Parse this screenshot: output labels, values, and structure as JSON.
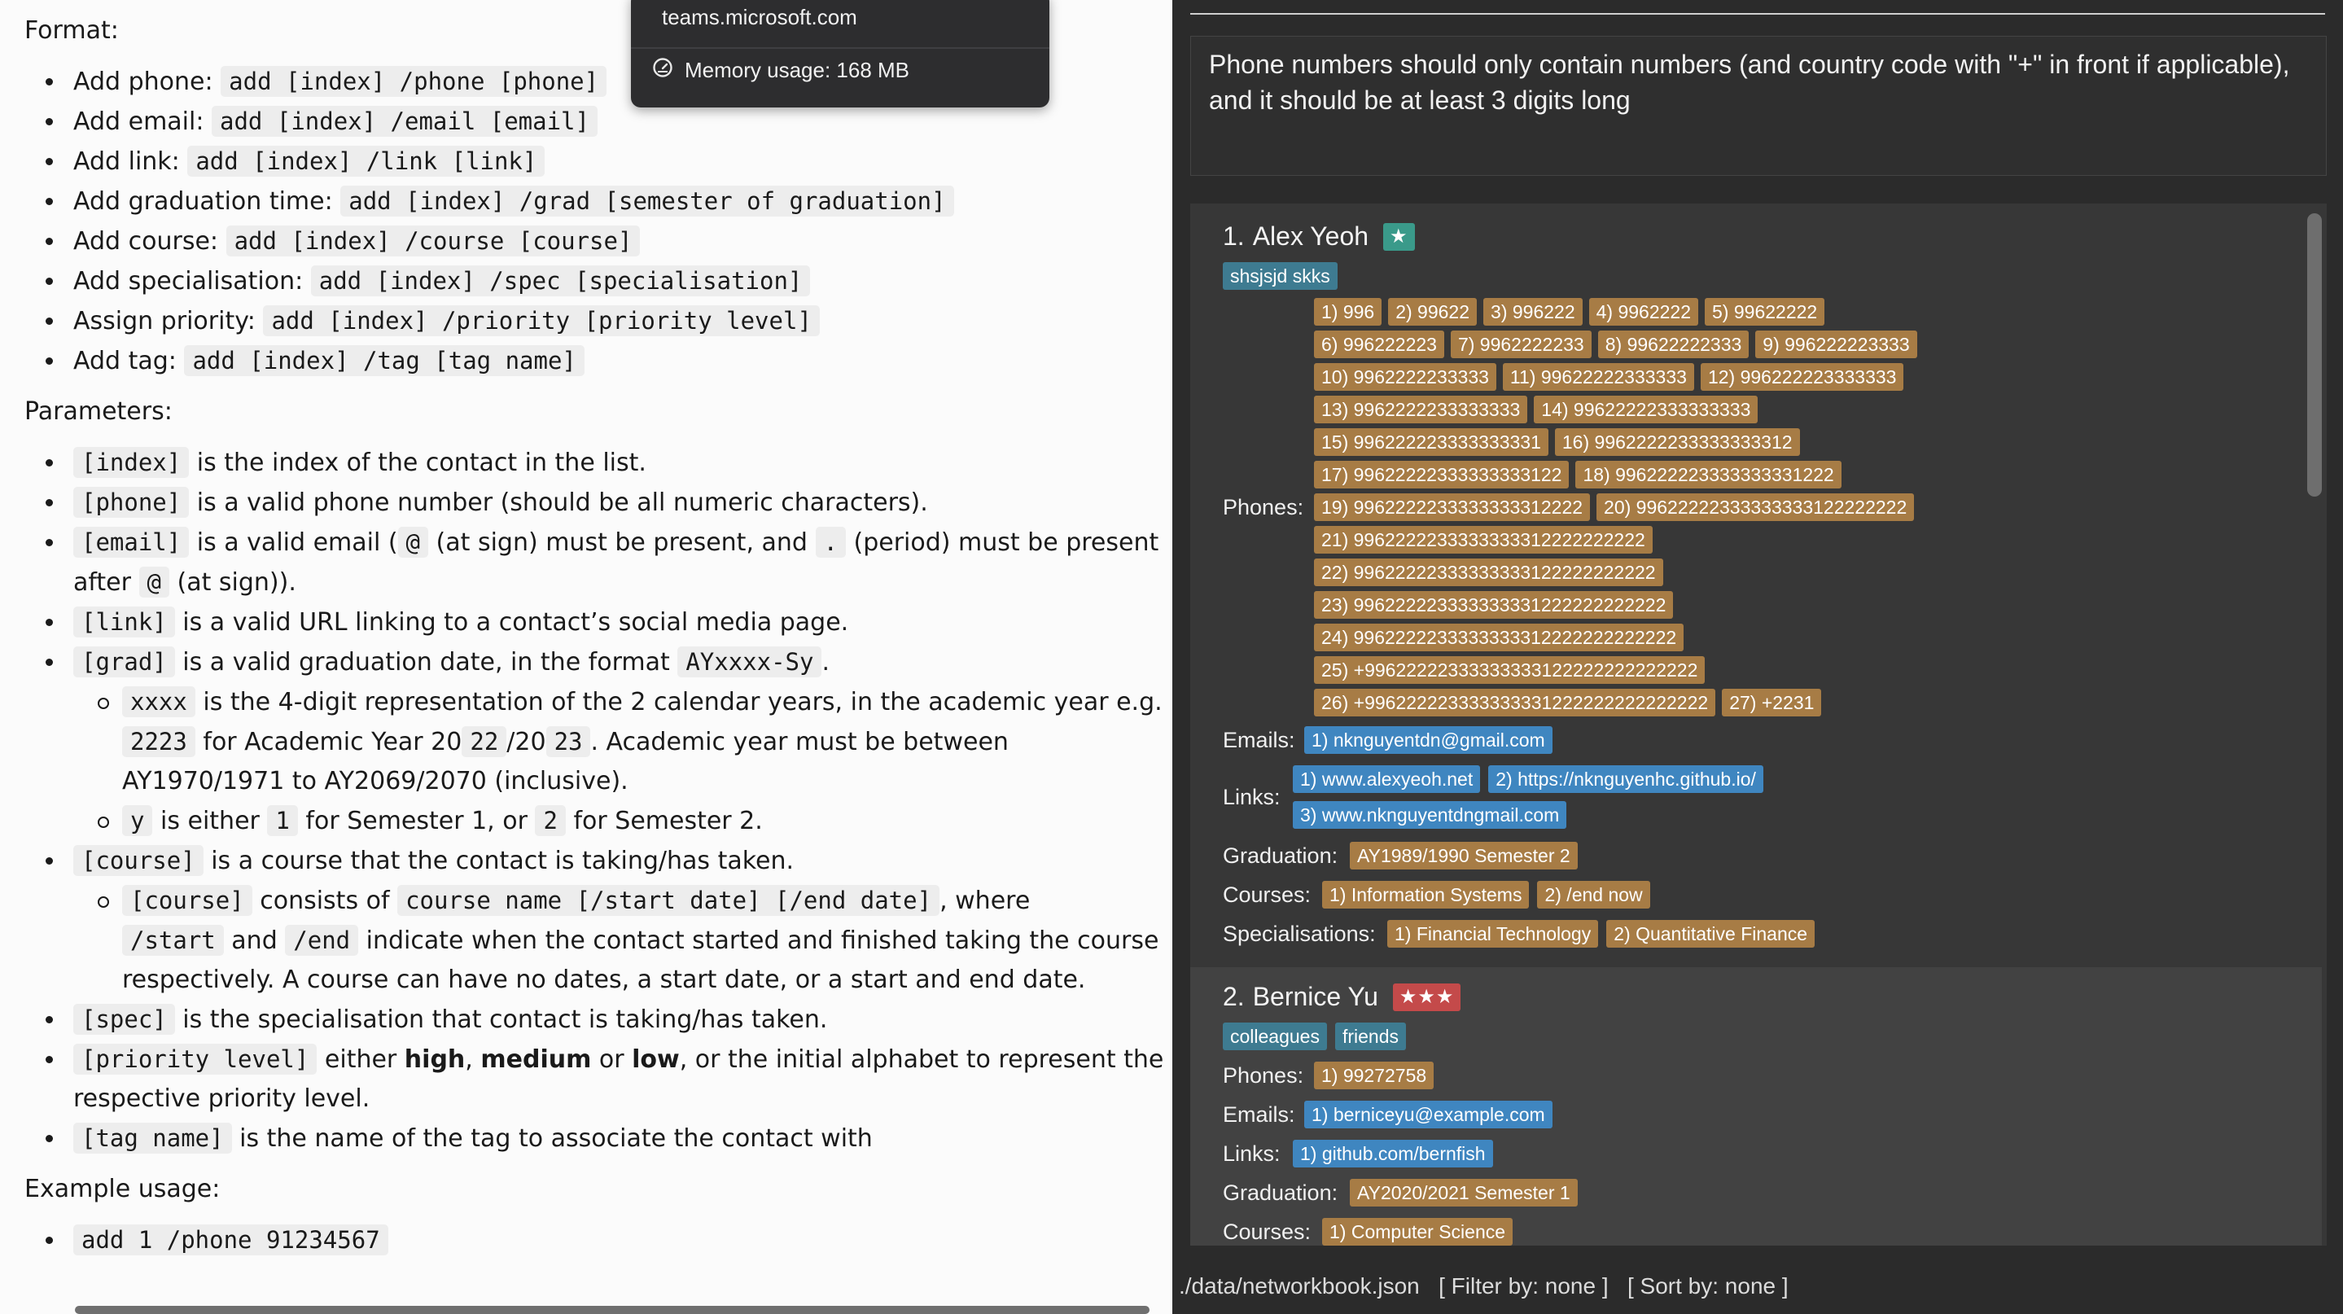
{
  "help": {
    "format_heading": "Format:",
    "format_items": [
      {
        "label": "Add phone:",
        "code": "add [index] /phone [phone]"
      },
      {
        "label": "Add email:",
        "code": "add [index] /email [email]"
      },
      {
        "label": "Add link:",
        "code": "add [index] /link [link]"
      },
      {
        "label": "Add graduation time:",
        "code": "add [index] /grad [semester of graduation]"
      },
      {
        "label": "Add course:",
        "code": "add [index] /course [course]"
      },
      {
        "label": "Add specialisation:",
        "code": "add [index] /spec [specialisation]"
      },
      {
        "label": "Assign priority:",
        "code": "add [index] /priority [priority level]"
      },
      {
        "label": "Add tag:",
        "code": "add [index] /tag [tag name]"
      }
    ],
    "params_heading": "Parameters:",
    "p_index_code": "[index]",
    "p_index_text": " is the index of the contact in the list.",
    "p_phone_code": "[phone]",
    "p_phone_text": " is a valid phone number (should be all numeric characters).",
    "p_email_code": "[email]",
    "p_email_t1": " is a valid email (",
    "p_email_at": "@",
    "p_email_t2": " (at sign) must be present, and ",
    "p_email_dot": ".",
    "p_email_t3": " (period) must be present",
    "p_email_t4": "after ",
    "p_email_t5": " (at sign)).",
    "p_link_code": "[link]",
    "p_link_text": " is a valid URL linking to a contact’s social media page.",
    "p_grad_code": "[grad]",
    "p_grad_t1": " is a valid graduation date, in the format ",
    "p_grad_fmt": "AYxxxx-Sy",
    "p_grad_t2": ".",
    "s_xxxx_code": "xxxx",
    "s_xxxx_t1": " is the 4-digit representation of the 2 calendar years, in the academic year e.g.",
    "s_xxxx_ex": "2223",
    "s_xxxx_t2": " for Academic Year 20",
    "s_xxxx_22": "22",
    "s_xxxx_t3": "/20",
    "s_xxxx_23": "23",
    "s_xxxx_t4": ". Academic year must be between",
    "s_xxxx_t5": "AY1970/1971 to AY2069/2070 (inclusive).",
    "s_y_code": "y",
    "s_y_t1": " is either ",
    "s_y_1": "1",
    "s_y_t2": " for Semester 1, or ",
    "s_y_2": "2",
    "s_y_t3": " for Semester 2.",
    "p_course_code": "[course]",
    "p_course_text": " is a course that the contact is taking/has taken.",
    "s_course_code": "[course]",
    "s_course_t1": " consists of ",
    "s_course_fmt": "course name [/start date] [/end date]",
    "s_course_t2": ", where",
    "s_course_start": "/start",
    "s_course_t3": " and ",
    "s_course_end": "/end",
    "s_course_t4": " indicate when the contact started and finished taking the course",
    "s_course_t5": "respectively. A course can have no dates, a start date, or a start and end date.",
    "p_spec_code": "[spec]",
    "p_spec_text": " is the specialisation that contact is taking/has taken.",
    "p_prio_code": "[priority level]",
    "p_prio_t1": " either ",
    "p_prio_high": "high",
    "p_prio_t2": ", ",
    "p_prio_med": "medium",
    "p_prio_t3": " or ",
    "p_prio_low": "low",
    "p_prio_t4": ", or the initial alphabet to represent the",
    "p_prio_t5": "respective priority level.",
    "p_tag_code": "[tag name]",
    "p_tag_text": " is the name of the tag to associate the contact with",
    "example_heading": "Example usage:",
    "example_code": "add 1 /phone 91234567"
  },
  "popup": {
    "host": "teams.microsoft.com",
    "memory": "Memory usage: 168 MB",
    "icon": "gauge-icon"
  },
  "app": {
    "result_message": "Phone numbers should only contain numbers (and country code with \"+\" in front if applicable), and it should be at least 3 digits long",
    "colors": {
      "tag": "#3e7b91",
      "phone": "#a77c45",
      "email": "#3f86c0",
      "prio1": "#3a9a8a",
      "prio3": "#c44a4a"
    },
    "contacts": [
      {
        "index": "1.",
        "name": "Alex Yeoh",
        "priority": "★",
        "tags": [
          "shsjsjd skks"
        ],
        "phones_label": "Phones:",
        "phones": [
          "1) 996",
          "2) 99622",
          "3) 996222",
          "4) 9962222",
          "5) 99622222",
          "6) 996222223",
          "7) 9962222233",
          "8) 99622222333",
          "9) 996222223333",
          "10) 9962222233333",
          "11) 99622222333333",
          "12) 996222223333333",
          "13) 9962222233333333",
          "14) 99622222333333333",
          "15) 996222223333333331",
          "16) 9962222233333333312",
          "17) 99622222333333333122",
          "18) 996222223333333331222",
          "19) 9962222233333333312222",
          "20) 99622222333333333122222222",
          "21) 9962222233333333312222222222",
          "22) 99622222333333333122222222222",
          "23) 996222223333333331222222222222",
          "24) 9962222233333333312222222222222",
          "25) +99622222333333333122222222222222",
          "26) +996222223333333331222222222222222",
          "27) +2231"
        ],
        "emails_label": "Emails:",
        "emails": [
          "1) nknguyentdn@gmail.com"
        ],
        "links_label": "Links:",
        "links": [
          "1) www.alexyeoh.net",
          "2) https://nknguyenhc.github.io/",
          "3) www.nknguyentdngmail.com"
        ],
        "graduation_label": "Graduation:",
        "graduation": "AY1989/1990 Semester 2",
        "courses_label": "Courses:",
        "courses": [
          "1) Information Systems",
          "2) /end now"
        ],
        "specs_label": "Specialisations:",
        "specs": [
          "1) Financial Technology",
          "2) Quantitative Finance"
        ]
      },
      {
        "index": "2.",
        "name": "Bernice Yu",
        "priority": "★★★",
        "tags": [
          "colleagues",
          "friends"
        ],
        "phones_label": "Phones:",
        "phones": [
          "1) 99272758"
        ],
        "emails_label": "Emails:",
        "emails": [
          "1) berniceyu@example.com"
        ],
        "links_label": "Links:",
        "links": [
          "1) github.com/bernfish"
        ],
        "graduation_label": "Graduation:",
        "graduation": "AY2020/2021 Semester 1",
        "courses_label": "Courses:",
        "courses": [
          "1) Computer Science"
        ]
      }
    ],
    "status": {
      "file": "./data/networkbook.json",
      "filter": "[ Filter by: none ]",
      "sort": "[ Sort by: none ]"
    }
  }
}
